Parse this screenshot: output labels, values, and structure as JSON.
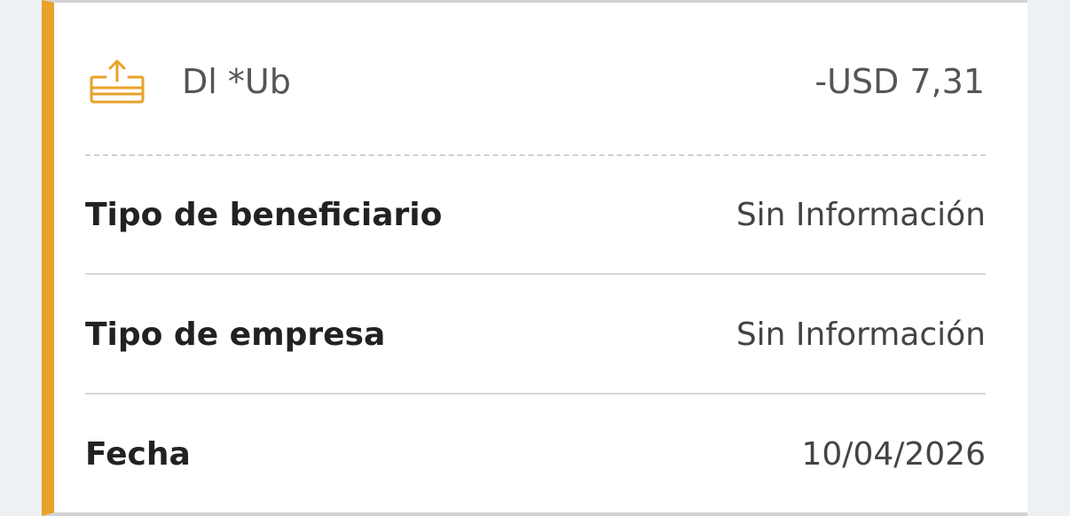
{
  "transaction": {
    "merchant": "Dl *Ub",
    "amount": "-USD 7,31",
    "icon": "outgoing-transfer-icon",
    "accent_color": "#e8a22a"
  },
  "details": [
    {
      "label": "Tipo de beneficiario",
      "value": "Sin Información"
    },
    {
      "label": "Tipo de empresa",
      "value": "Sin Información"
    },
    {
      "label": "Fecha",
      "value": "10/04/2026"
    }
  ]
}
